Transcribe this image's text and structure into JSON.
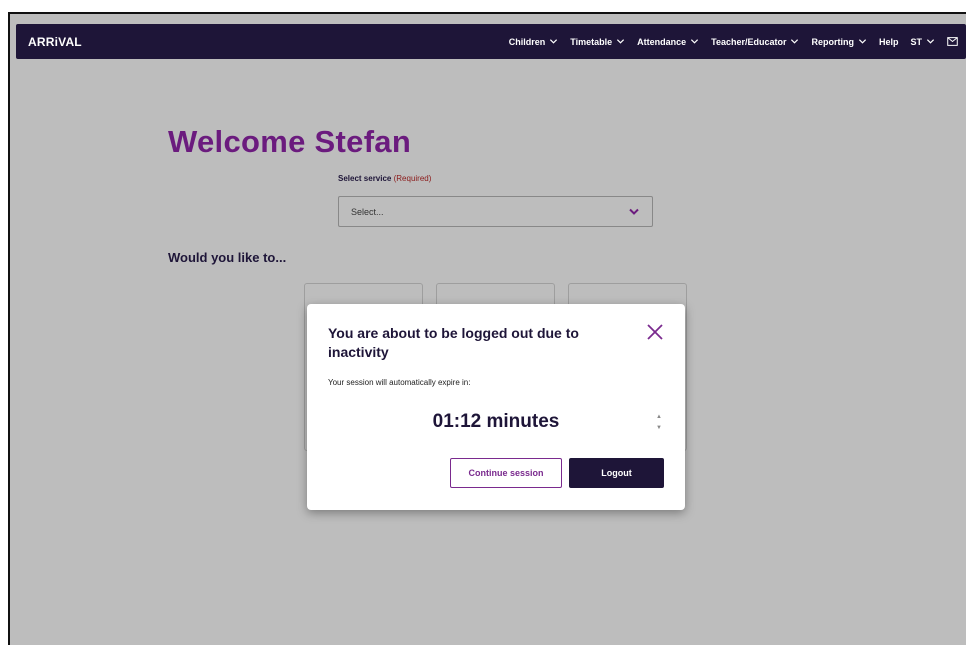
{
  "header": {
    "logo": "ARRiVAL",
    "nav": [
      {
        "label": "Children"
      },
      {
        "label": "Timetable"
      },
      {
        "label": "Attendance"
      },
      {
        "label": "Teacher/Educator"
      },
      {
        "label": "Reporting"
      },
      {
        "label": "Help"
      },
      {
        "label": "ST"
      }
    ]
  },
  "main": {
    "welcome": "Welcome Stefan",
    "select_label": "Select service",
    "select_required": "(Required)",
    "select_placeholder": "Select...",
    "would_you_like": "Would you like to..."
  },
  "modal": {
    "title": "You are about to be logged out due to inactivity",
    "subtitle": "Your session will automatically expire in:",
    "timer": "01:12 minutes",
    "continue_label": "Continue session",
    "logout_label": "Logout"
  },
  "colors": {
    "navy": "#1e1538",
    "purple": "#6b1b7e",
    "overlay": "#bdbdbd"
  }
}
